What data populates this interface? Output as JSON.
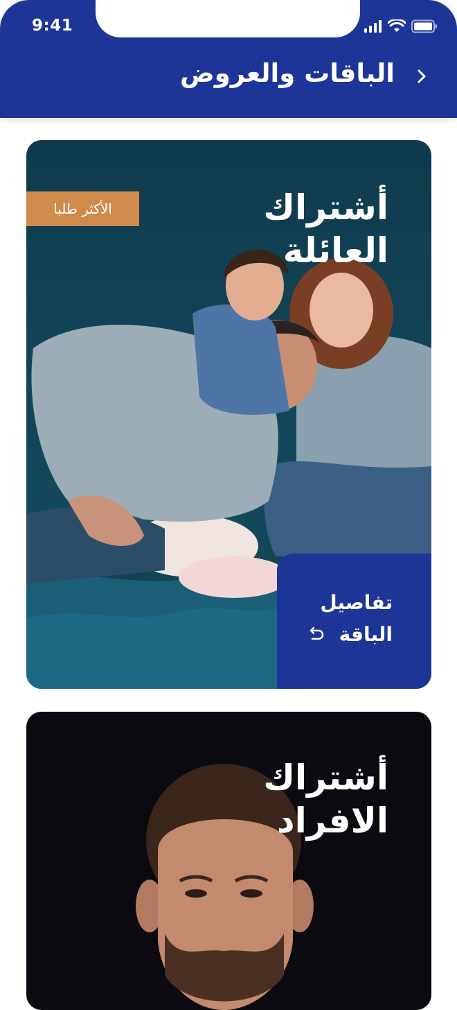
{
  "status_bar": {
    "time": "9:41"
  },
  "header": {
    "title": "الباقات والعروض",
    "back_icon": "chevron-right-icon"
  },
  "cards": [
    {
      "title_line1": "أشتراك",
      "title_line2": "العائلة",
      "badge": "الأكثر طلبا",
      "details_line1": "تفاصيل",
      "details_line2": "الباقة",
      "details_icon": "undo-arrow-icon",
      "image": "family-photo"
    },
    {
      "title_line1": "أشتراك",
      "title_line2": "الافراد",
      "image": "man-portrait-photo"
    }
  ],
  "colors": {
    "brand_blue": "#1e3598",
    "badge_orange": "#d08a4b",
    "family_bg": "#124558",
    "individual_bg": "#0b0a10"
  }
}
